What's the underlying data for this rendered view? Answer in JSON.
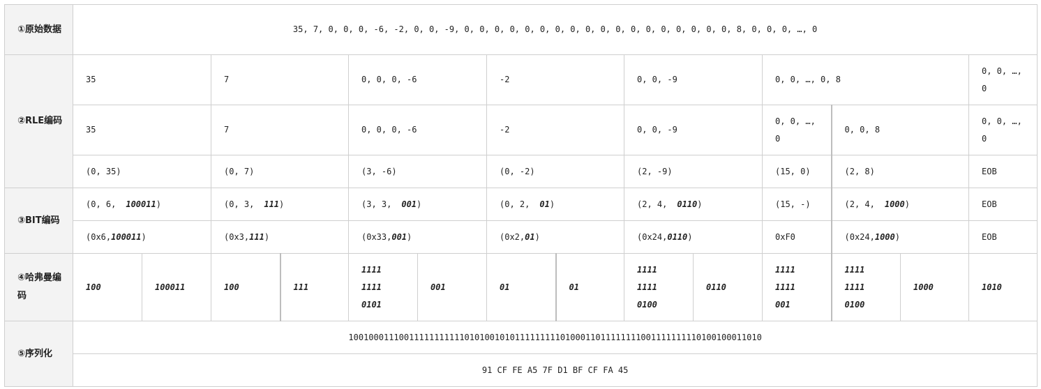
{
  "labels": {
    "raw": "①原始数据",
    "rle": "②RLE编码",
    "bit": "③BIT编码",
    "huffman": "④哈弗曼编码",
    "serialize": "⑤序列化"
  },
  "raw_data": "35, 7, 0, 0, 0, -6, -2, 0, 0, -9, 0, 0, 0, 0, 0, 0, 0, 0, 0, 0, 0, 0, 0, 0, 0, 0, 0, 0, 8, 0, 0, 0, …, 0",
  "rle_row1": [
    "35",
    "7",
    "0, 0, 0, -6",
    "-2",
    "0, 0, -9",
    "0, 0, …, 0, 8",
    "0, 0, …, 0"
  ],
  "rle_row2": [
    "35",
    "7",
    "0, 0, 0, -6",
    "-2",
    "0, 0, -9",
    "0, 0, …, 0",
    "0, 0, 8",
    "0, 0, …, 0"
  ],
  "rle_row3": [
    "(0, 35)",
    "(0, 7)",
    "(3, -6)",
    "(0, -2)",
    "(2, -9)",
    "(15, 0)",
    "(2, 8)",
    "EOB"
  ],
  "bit_row1": [
    {
      "pre": "(0, 6,",
      "bits": "100011",
      "post": ")"
    },
    {
      "pre": "(0, 3,",
      "bits": "111",
      "post": ")"
    },
    {
      "pre": "(3, 3,",
      "bits": "001",
      "post": ")"
    },
    {
      "pre": "(0, 2,",
      "bits": "01",
      "post": ")"
    },
    {
      "pre": "(2, 4,",
      "bits": "0110",
      "post": ")"
    },
    {
      "pre": "(15, -)",
      "bits": "",
      "post": ""
    },
    {
      "pre": "(2, 4,",
      "bits": "1000",
      "post": ")"
    },
    {
      "pre": "EOB",
      "bits": "",
      "post": ""
    }
  ],
  "bit_row2": [
    {
      "pre": "(0x6,",
      "bits": "100011",
      "post": ")"
    },
    {
      "pre": "(0x3,",
      "bits": "111",
      "post": ")"
    },
    {
      "pre": "(0x33,",
      "bits": "001",
      "post": ")"
    },
    {
      "pre": "(0x2,",
      "bits": "01",
      "post": ")"
    },
    {
      "pre": "(0x24,",
      "bits": "0110",
      "post": ")"
    },
    {
      "pre": "0xF0",
      "bits": "",
      "post": ""
    },
    {
      "pre": "(0x24,",
      "bits": "1000",
      "post": ")"
    },
    {
      "pre": "EOB",
      "bits": "",
      "post": ""
    }
  ],
  "huffman": [
    [
      "100"
    ],
    [
      "100011"
    ],
    [
      "100"
    ],
    [
      "111"
    ],
    [
      "1111",
      "1111",
      "0101"
    ],
    [
      "001"
    ],
    [
      "01"
    ],
    [
      "01"
    ],
    [
      "1111",
      "1111",
      "0100"
    ],
    [
      "0110"
    ],
    [
      "1111",
      "1111",
      "001"
    ],
    [
      "1111",
      "1111",
      "0100"
    ],
    [
      "1000"
    ],
    [
      "1010"
    ]
  ],
  "serialize_bits": "1001000111001111111111101010010101111111110100011011111111001111111110100100011010",
  "serialize_hex": "91 CF FE A5 7F D1 BF CF FA 45"
}
